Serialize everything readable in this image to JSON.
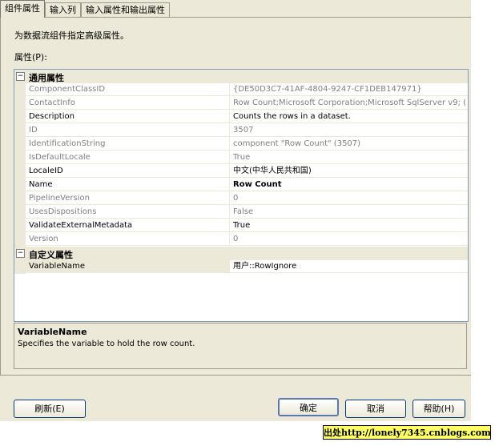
{
  "tabs": [
    {
      "label": "组件属性",
      "active": true
    },
    {
      "label": "输入列",
      "active": false
    },
    {
      "label": "输入属性和输出属性",
      "active": false
    }
  ],
  "intro": "为数据流组件指定高级属性。",
  "props_label": "属性(P):",
  "categories": [
    {
      "label": "通用属性",
      "toggle": "−",
      "rows": [
        {
          "name": "ComponentClassID",
          "value": "{DE50D3C7-41AF-4804-9247-CF1DEB147971}",
          "readonly": true
        },
        {
          "name": "ContactInfo",
          "value": "Row Count;Microsoft Corporation;Microsoft SqlServer v9; (",
          "readonly": true
        },
        {
          "name": "Description",
          "value": "Counts the rows in a dataset.",
          "readonly": false
        },
        {
          "name": "ID",
          "value": "3507",
          "readonly": true
        },
        {
          "name": "IdentificationString",
          "value": "component \"Row Count\" (3507)",
          "readonly": true
        },
        {
          "name": "IsDefaultLocale",
          "value": "True",
          "readonly": true
        },
        {
          "name": "LocaleID",
          "value": "中文(中华人民共和国)",
          "readonly": false
        },
        {
          "name": "Name",
          "value": "Row Count",
          "readonly": false,
          "bold": true
        },
        {
          "name": "PipelineVersion",
          "value": "0",
          "readonly": true
        },
        {
          "name": "UsesDispositions",
          "value": "False",
          "readonly": true
        },
        {
          "name": "ValidateExternalMetadata",
          "value": "True",
          "readonly": false
        },
        {
          "name": "Version",
          "value": "0",
          "readonly": true
        }
      ]
    },
    {
      "label": "自定义属性",
      "toggle": "−",
      "rows": [
        {
          "name": "VariableName",
          "value": "用户::RowIgnore",
          "readonly": false,
          "selected": true
        }
      ]
    }
  ],
  "description": {
    "title": "VariableName",
    "text": "Specifies the variable to hold the row count."
  },
  "buttons": {
    "refresh": "刷新(E)",
    "ok": "确定",
    "cancel": "取消",
    "help": "帮助(H)"
  },
  "watermark": "出处http://lonely7345.cnblogs.com",
  "colors": {
    "dialog_bg": "#ece9d8",
    "readonly_text": "#808080",
    "grid_border": "#7f9db9",
    "watermark_bg": "#ffff66"
  }
}
